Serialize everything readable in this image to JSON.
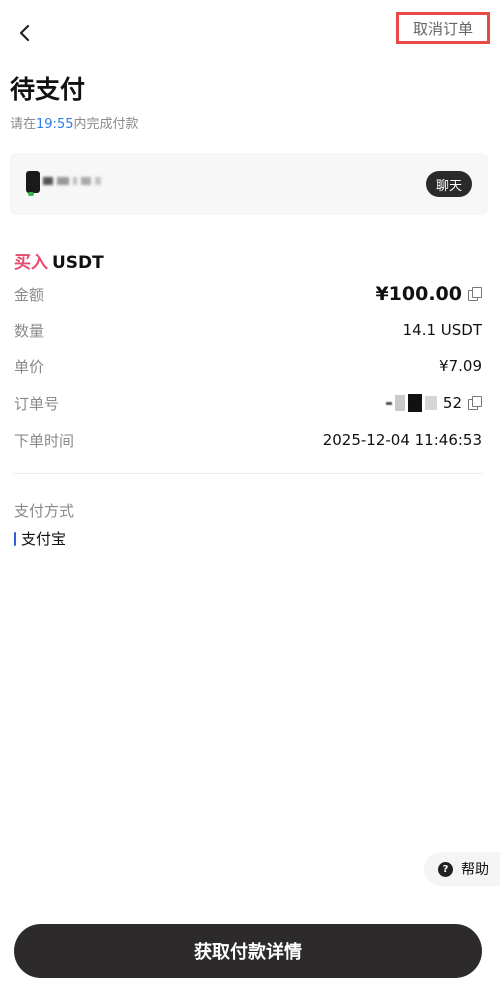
{
  "header": {
    "back_icon": "chevron-left-icon",
    "cancel_label": "取消订单",
    "cancel_highlight_color": "#e84848"
  },
  "title": "待支付",
  "pay_hint": {
    "prefix": "请在",
    "time": "19:55",
    "suffix": "内完成付款",
    "time_color": "#2e7de8"
  },
  "merchant": {
    "chat_label": "聊天"
  },
  "order": {
    "side": "买入",
    "coin": "USDT",
    "side_color": "#e84a6f",
    "rows": [
      {
        "label": "金额",
        "value": "¥100.00"
      },
      {
        "label": "数量",
        "value": "14.1 USDT"
      },
      {
        "label": "单价",
        "value": "¥7.09"
      },
      {
        "label": "订单号",
        "value": "52"
      },
      {
        "label": "下单时间",
        "value": "2025-12-04 11:46:53"
      }
    ]
  },
  "payment": {
    "label": "支付方式",
    "method": "支付宝",
    "method_bar_color": "#2e5fd8"
  },
  "help": {
    "label": "帮助",
    "icon_glyph": "?"
  },
  "cta": {
    "label": "获取付款详情"
  }
}
